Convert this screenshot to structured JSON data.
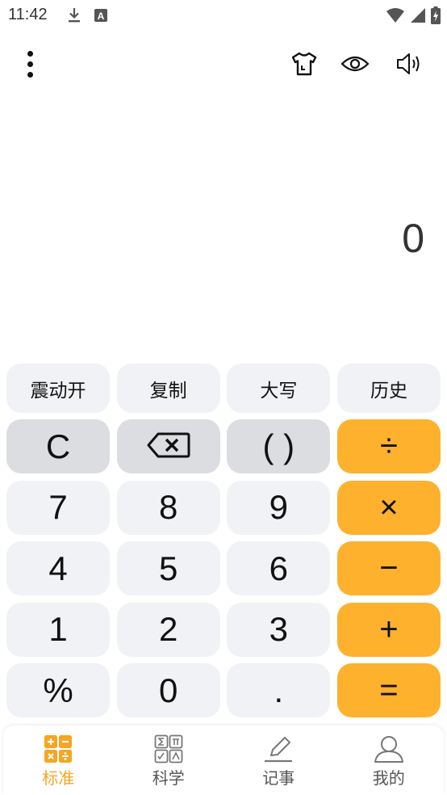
{
  "status_bar": {
    "time": "11:42",
    "left_icons": [
      "download-icon",
      "a-notification-icon"
    ],
    "right_icons": [
      "wifi-icon",
      "signal-icon",
      "battery-icon"
    ]
  },
  "toolbar": {
    "menu_icon": "more-vertical-icon",
    "actions": [
      "tshirt-skin-icon",
      "eye-icon",
      "speaker-icon"
    ]
  },
  "display": {
    "value": "0"
  },
  "function_row": [
    {
      "label": "震动开"
    },
    {
      "label": "复制"
    },
    {
      "label": "大写"
    },
    {
      "label": "历史"
    }
  ],
  "keypad": {
    "rows": [
      [
        {
          "label": "C"
        },
        {
          "label": ""
        },
        {
          "label": "( )"
        },
        {
          "label": "÷"
        }
      ],
      [
        {
          "label": "7"
        },
        {
          "label": "8"
        },
        {
          "label": "9"
        },
        {
          "label": "×"
        }
      ],
      [
        {
          "label": "4"
        },
        {
          "label": "5"
        },
        {
          "label": "6"
        },
        {
          "label": "−"
        }
      ],
      [
        {
          "label": "1"
        },
        {
          "label": "2"
        },
        {
          "label": "3"
        },
        {
          "label": "+"
        }
      ],
      [
        {
          "label": "%"
        },
        {
          "label": "0"
        },
        {
          "label": "."
        },
        {
          "label": "="
        }
      ]
    ],
    "backspace_icon": "backspace-icon"
  },
  "tabs": [
    {
      "label": "标准",
      "icon": "standard-calc-icon",
      "active": true
    },
    {
      "label": "科学",
      "icon": "scientific-calc-icon",
      "active": false
    },
    {
      "label": "记事",
      "icon": "note-pencil-icon",
      "active": false
    },
    {
      "label": "我的",
      "icon": "user-profile-icon",
      "active": false
    }
  ],
  "colors": {
    "accent": "#fdb12d",
    "tab_active": "#f6a623",
    "key_light": "#f1f2f5",
    "key_dark": "#dcdde1"
  }
}
